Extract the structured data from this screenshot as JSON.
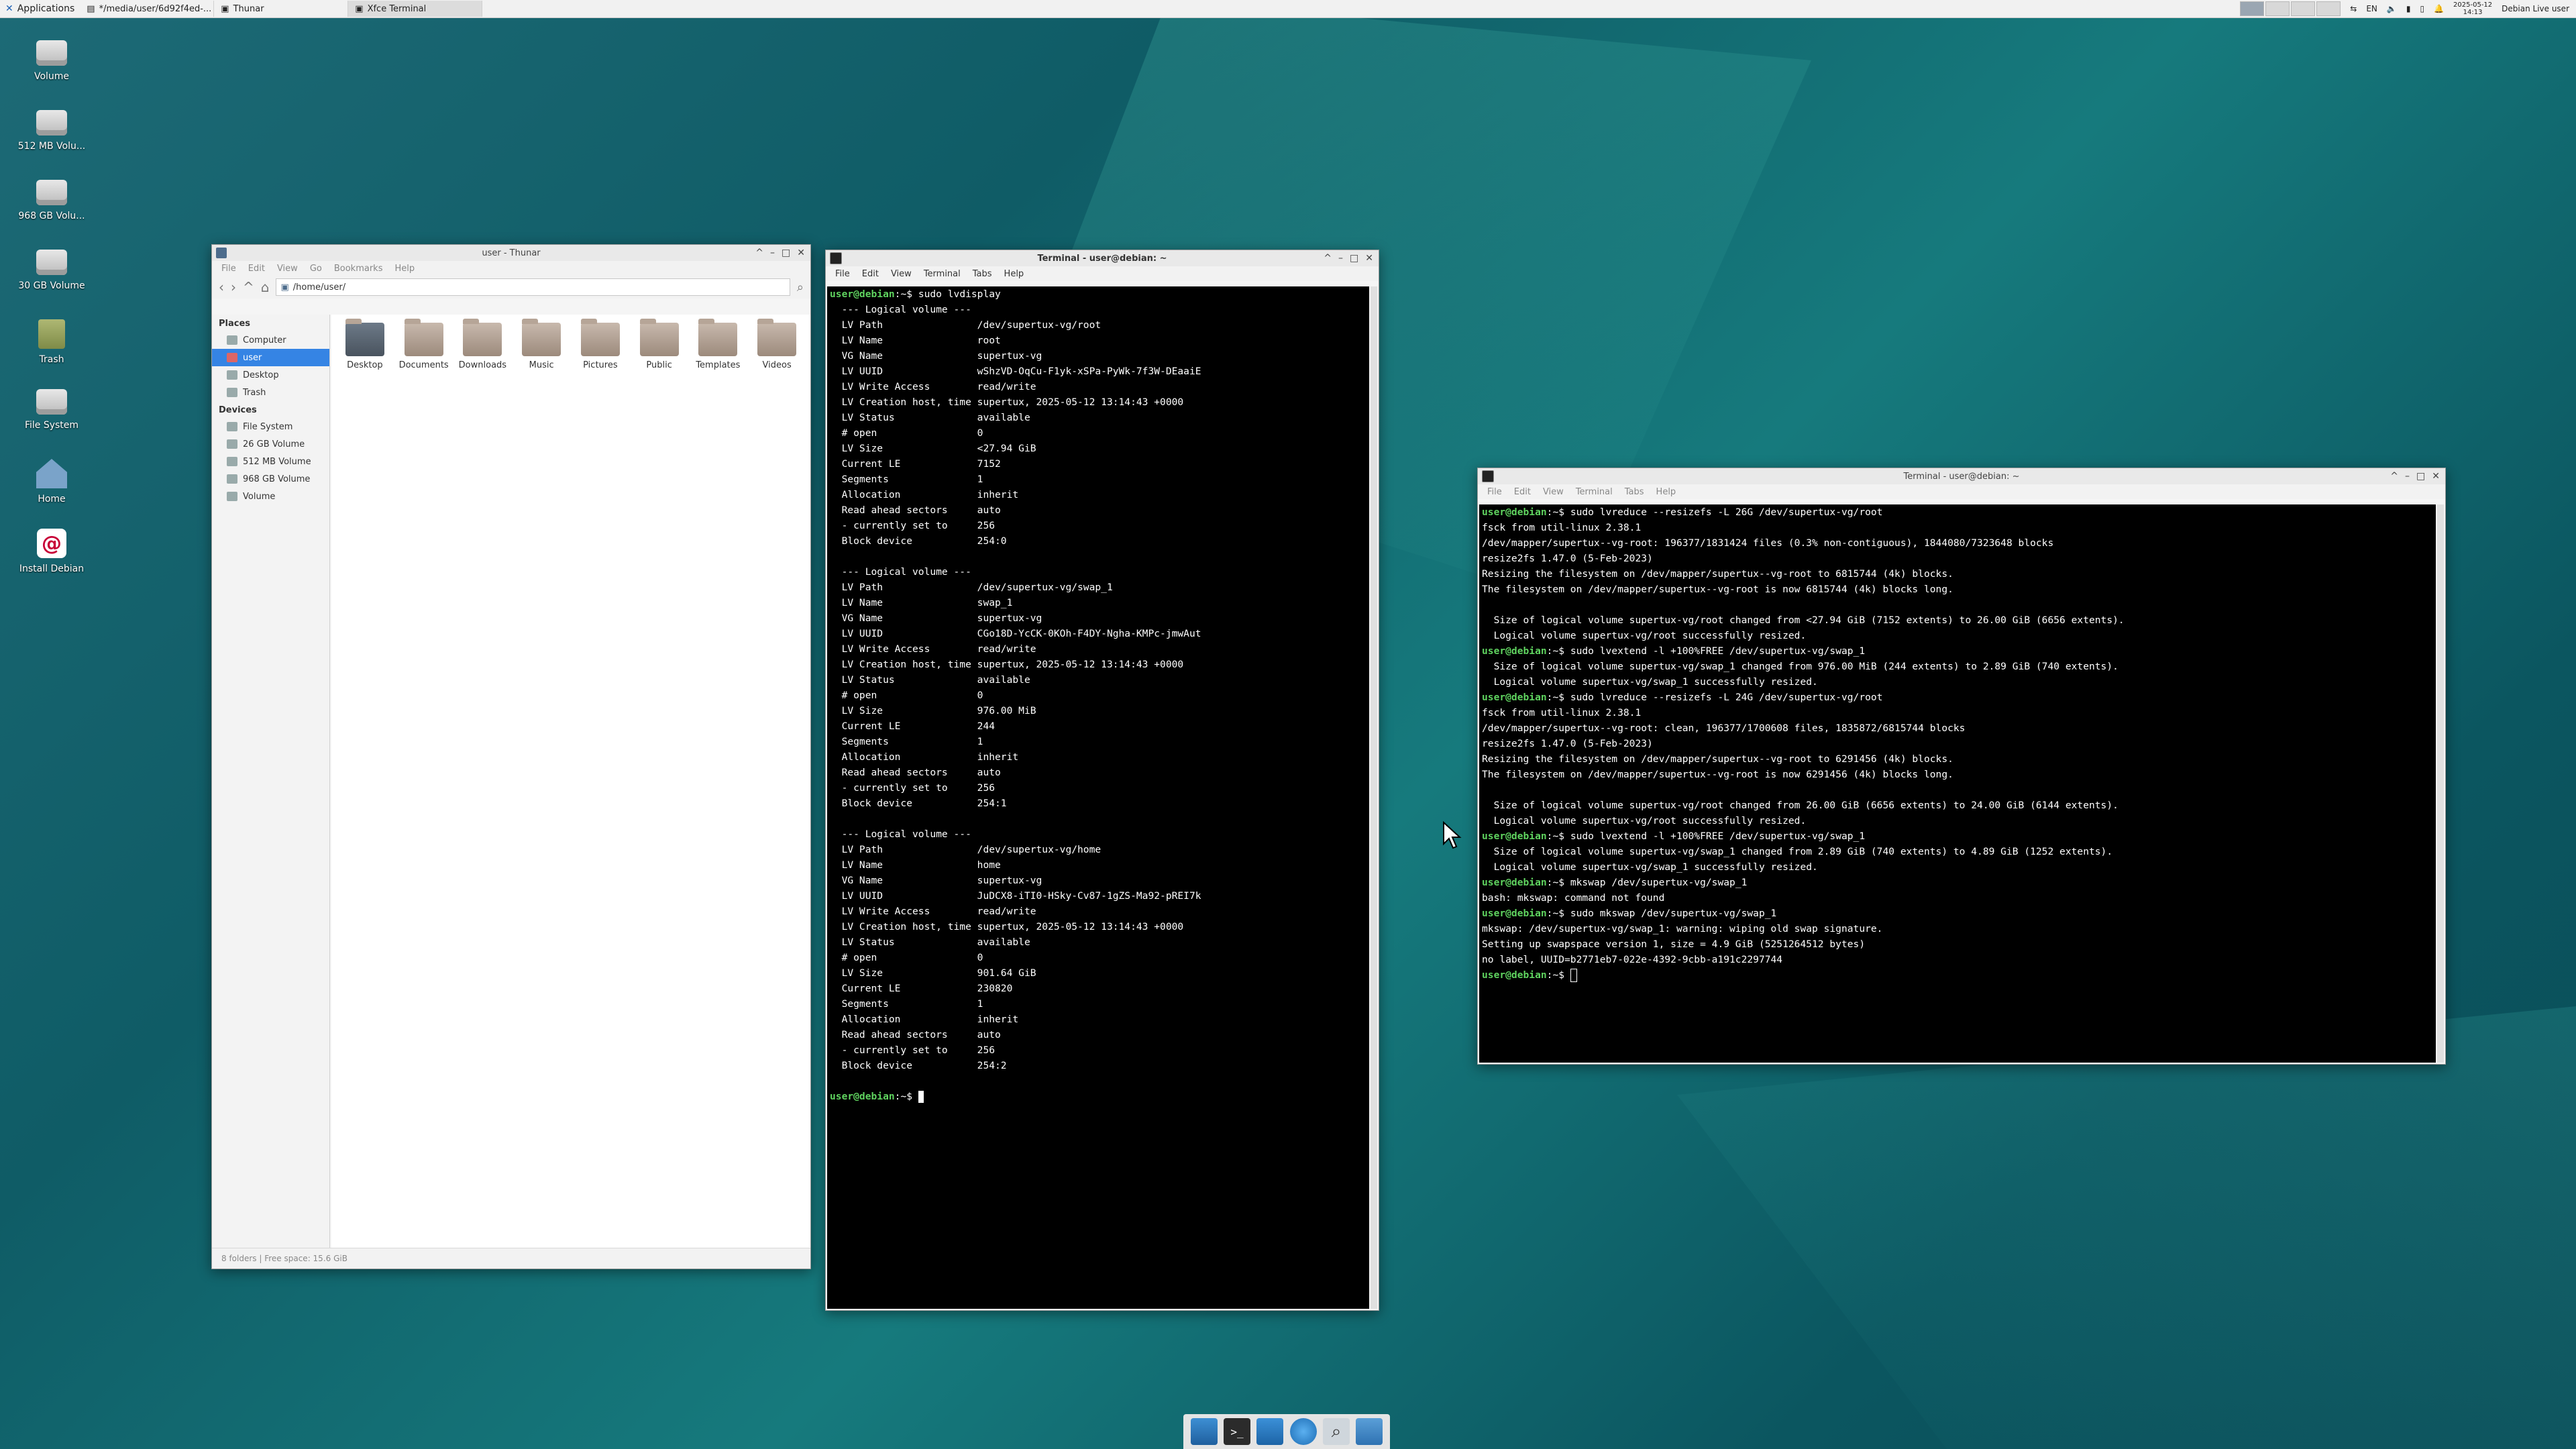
{
  "panel": {
    "applications_label": "Applications",
    "tasks": [
      {
        "label": "*/media/user/6d92f4ed-...",
        "active": false
      },
      {
        "label": "Thunar",
        "active": false
      },
      {
        "label": "Xfce Terminal",
        "active": true
      }
    ],
    "keyboard_layout": "EN",
    "date": "2025-05-12",
    "time": "14:13",
    "user_label": "Debian Live user"
  },
  "desktop_icons": [
    {
      "label": "Volume",
      "icon": "drive-icon"
    },
    {
      "label": "512 MB Volu...",
      "icon": "drive-icon"
    },
    {
      "label": "968 GB Volu...",
      "icon": "drive-icon"
    },
    {
      "label": "30 GB Volume",
      "icon": "drive-icon"
    },
    {
      "label": "Trash",
      "icon": "trash-icon"
    },
    {
      "label": "File System",
      "icon": "drive-icon"
    },
    {
      "label": "Home",
      "icon": "home-icon"
    },
    {
      "label": "Install Debian",
      "icon": "debian-icon"
    }
  ],
  "thunar": {
    "title": "user - Thunar",
    "menu": [
      "File",
      "Edit",
      "View",
      "Go",
      "Bookmarks",
      "Help"
    ],
    "path": "/home/user/",
    "sidebar": {
      "places_header": "Places",
      "places": [
        "Computer",
        "user",
        "Desktop",
        "Trash"
      ],
      "devices_header": "Devices",
      "devices": [
        "File System",
        "26 GB Volume",
        "512 MB Volume",
        "968 GB Volume",
        "Volume"
      ]
    },
    "folders": [
      "Desktop",
      "Documents",
      "Downloads",
      "Music",
      "Pictures",
      "Public",
      "Templates",
      "Videos"
    ],
    "status": "8 folders  |  Free space: 15.6 GiB"
  },
  "terminal1": {
    "title": "Terminal - user@debian: ~",
    "menu": [
      "File",
      "Edit",
      "View",
      "Terminal",
      "Tabs",
      "Help"
    ],
    "prompt": "user@debian",
    "prompt_suffix": ":~$ ",
    "command": "sudo lvdisplay",
    "volumes": [
      {
        "header": "  --- Logical volume ---",
        "rows": [
          [
            "LV Path",
            "/dev/supertux-vg/root"
          ],
          [
            "LV Name",
            "root"
          ],
          [
            "VG Name",
            "supertux-vg"
          ],
          [
            "LV UUID",
            "wShzVD-OqCu-F1yk-xSPa-PyWk-7f3W-DEaaiE"
          ],
          [
            "LV Write Access",
            "read/write"
          ],
          [
            "LV Creation host, time",
            "supertux, 2025-05-12 13:14:43 +0000"
          ],
          [
            "LV Status",
            "available"
          ],
          [
            "# open",
            "0"
          ],
          [
            "LV Size",
            "<27.94 GiB"
          ],
          [
            "Current LE",
            "7152"
          ],
          [
            "Segments",
            "1"
          ],
          [
            "Allocation",
            "inherit"
          ],
          [
            "Read ahead sectors",
            "auto"
          ],
          [
            "- currently set to",
            "256"
          ],
          [
            "Block device",
            "254:0"
          ]
        ]
      },
      {
        "header": "  --- Logical volume ---",
        "rows": [
          [
            "LV Path",
            "/dev/supertux-vg/swap_1"
          ],
          [
            "LV Name",
            "swap_1"
          ],
          [
            "VG Name",
            "supertux-vg"
          ],
          [
            "LV UUID",
            "CGo18D-YcCK-0KOh-F4DY-Ngha-KMPc-jmwAut"
          ],
          [
            "LV Write Access",
            "read/write"
          ],
          [
            "LV Creation host, time",
            "supertux, 2025-05-12 13:14:43 +0000"
          ],
          [
            "LV Status",
            "available"
          ],
          [
            "# open",
            "0"
          ],
          [
            "LV Size",
            "976.00 MiB"
          ],
          [
            "Current LE",
            "244"
          ],
          [
            "Segments",
            "1"
          ],
          [
            "Allocation",
            "inherit"
          ],
          [
            "Read ahead sectors",
            "auto"
          ],
          [
            "- currently set to",
            "256"
          ],
          [
            "Block device",
            "254:1"
          ]
        ]
      },
      {
        "header": "  --- Logical volume ---",
        "rows": [
          [
            "LV Path",
            "/dev/supertux-vg/home"
          ],
          [
            "LV Name",
            "home"
          ],
          [
            "VG Name",
            "supertux-vg"
          ],
          [
            "LV UUID",
            "JuDCX8-iTI0-HSky-Cv87-1gZS-Ma92-pREI7k"
          ],
          [
            "LV Write Access",
            "read/write"
          ],
          [
            "LV Creation host, time",
            "supertux, 2025-05-12 13:14:43 +0000"
          ],
          [
            "LV Status",
            "available"
          ],
          [
            "# open",
            "0"
          ],
          [
            "LV Size",
            "901.64 GiB"
          ],
          [
            "Current LE",
            "230820"
          ],
          [
            "Segments",
            "1"
          ],
          [
            "Allocation",
            "inherit"
          ],
          [
            "Read ahead sectors",
            "auto"
          ],
          [
            "- currently set to",
            "256"
          ],
          [
            "Block device",
            "254:2"
          ]
        ]
      }
    ]
  },
  "terminal2": {
    "title": "Terminal - user@debian: ~",
    "menu": [
      "File",
      "Edit",
      "View",
      "Terminal",
      "Tabs",
      "Help"
    ],
    "lines": [
      {
        "prompt": "user@debian",
        "suffix": ":~$ ",
        "text": "sudo lvreduce --resizefs -L 26G /dev/supertux-vg/root"
      },
      {
        "text": "fsck from util-linux 2.38.1"
      },
      {
        "text": "/dev/mapper/supertux--vg-root: 196377/1831424 files (0.3% non-contiguous), 1844080/7323648 blocks"
      },
      {
        "text": "resize2fs 1.47.0 (5-Feb-2023)"
      },
      {
        "text": "Resizing the filesystem on /dev/mapper/supertux--vg-root to 6815744 (4k) blocks."
      },
      {
        "text": "The filesystem on /dev/mapper/supertux--vg-root is now 6815744 (4k) blocks long."
      },
      {
        "text": ""
      },
      {
        "text": "  Size of logical volume supertux-vg/root changed from <27.94 GiB (7152 extents) to 26.00 GiB (6656 extents)."
      },
      {
        "text": "  Logical volume supertux-vg/root successfully resized."
      },
      {
        "prompt": "user@debian",
        "suffix": ":~$ ",
        "text": "sudo lvextend -l +100%FREE /dev/supertux-vg/swap_1"
      },
      {
        "text": "  Size of logical volume supertux-vg/swap_1 changed from 976.00 MiB (244 extents) to 2.89 GiB (740 extents)."
      },
      {
        "text": "  Logical volume supertux-vg/swap_1 successfully resized."
      },
      {
        "prompt": "user@debian",
        "suffix": ":~$ ",
        "text": "sudo lvreduce --resizefs -L 24G /dev/supertux-vg/root"
      },
      {
        "text": "fsck from util-linux 2.38.1"
      },
      {
        "text": "/dev/mapper/supertux--vg-root: clean, 196377/1700608 files, 1835872/6815744 blocks"
      },
      {
        "text": "resize2fs 1.47.0 (5-Feb-2023)"
      },
      {
        "text": "Resizing the filesystem on /dev/mapper/supertux--vg-root to 6291456 (4k) blocks."
      },
      {
        "text": "The filesystem on /dev/mapper/supertux--vg-root is now 6291456 (4k) blocks long."
      },
      {
        "text": ""
      },
      {
        "text": "  Size of logical volume supertux-vg/root changed from 26.00 GiB (6656 extents) to 24.00 GiB (6144 extents)."
      },
      {
        "text": "  Logical volume supertux-vg/root successfully resized."
      },
      {
        "prompt": "user@debian",
        "suffix": ":~$ ",
        "text": "sudo lvextend -l +100%FREE /dev/supertux-vg/swap_1"
      },
      {
        "text": "  Size of logical volume supertux-vg/swap_1 changed from 2.89 GiB (740 extents) to 4.89 GiB (1252 extents)."
      },
      {
        "text": "  Logical volume supertux-vg/swap_1 successfully resized."
      },
      {
        "prompt": "user@debian",
        "suffix": ":~$ ",
        "text": "mkswap /dev/supertux-vg/swap_1"
      },
      {
        "text": "bash: mkswap: command not found"
      },
      {
        "prompt": "user@debian",
        "suffix": ":~$ ",
        "text": "sudo mkswap /dev/supertux-vg/swap_1"
      },
      {
        "text": "mkswap: /dev/supertux-vg/swap_1: warning: wiping old swap signature."
      },
      {
        "text": "Setting up swapspace version 1, size = 4.9 GiB (5251264512 bytes)"
      },
      {
        "text": "no label, UUID=b2771eb7-022e-4392-9cbb-a191c2297744"
      }
    ],
    "final_prompt": "user@debian",
    "final_suffix": ":~$ "
  },
  "dock": [
    "show-desktop-icon",
    "terminal-icon",
    "file-manager-icon",
    "web-browser-icon",
    "search-icon",
    "folder-icon"
  ]
}
